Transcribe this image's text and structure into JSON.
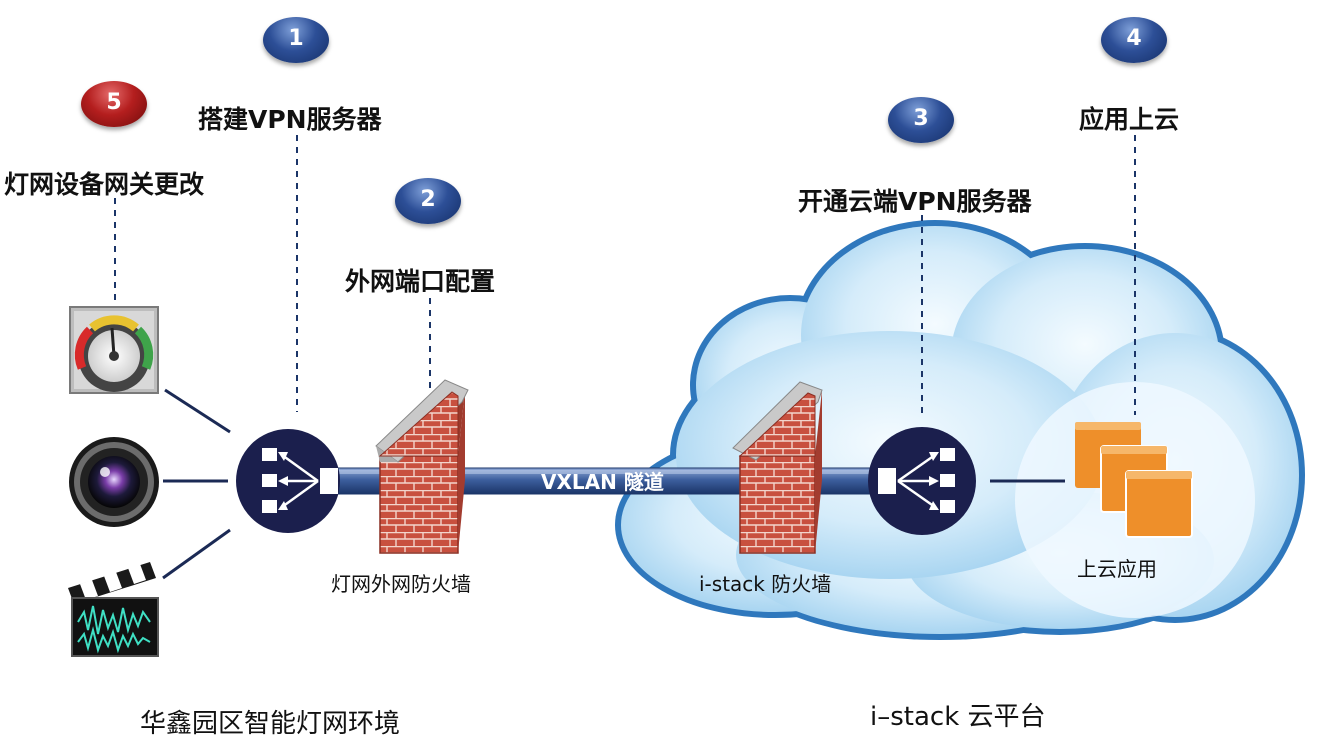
{
  "steps": [
    {
      "num": "1",
      "label": "搭建VPN服务器"
    },
    {
      "num": "2",
      "label": "外网端口配置"
    },
    {
      "num": "3",
      "label": "开通云端VPN服务器"
    },
    {
      "num": "4",
      "label": "应用上云"
    },
    {
      "num": "5",
      "label": "灯网设备网关更改"
    }
  ],
  "tunnel_label": "VXLAN 隧道",
  "captions": {
    "firewall_left": "灯网外网防火墙",
    "firewall_right": "i-stack 防火墙",
    "cloud_app": "上云应用"
  },
  "zones": {
    "left": "华鑫园区智能灯网环境",
    "right": "i–stack 云平台"
  },
  "colors": {
    "badge_blue": "#2d4f97",
    "badge_red": "#b41e1e",
    "router_navy": "#1b1f4d",
    "tunnel": "#3a5a96",
    "brick": "#c44a3b",
    "cloud_edge": "#2f78bd",
    "app_orange": "#ee8f2a"
  }
}
